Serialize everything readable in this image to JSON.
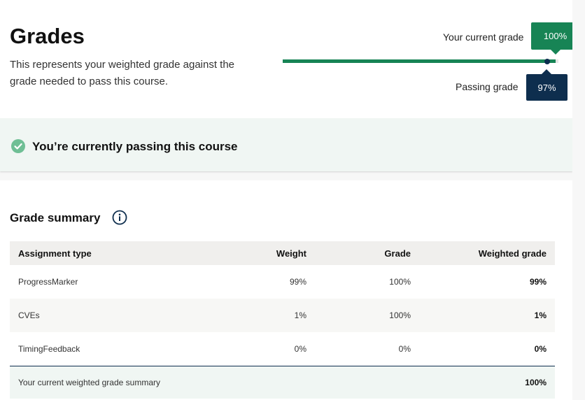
{
  "header": {
    "title": "Grades",
    "description": "This represents your weighted grade against the grade needed to pass this course."
  },
  "progress": {
    "current_label": "Your current grade",
    "current_value": "100%",
    "current_fraction": 1.0,
    "passing_label": "Passing grade",
    "passing_value": "97%",
    "passing_fraction": 0.97,
    "fill_color": "#178455",
    "marker_color": "#0e2e4e"
  },
  "status": {
    "icon": "check-circle-icon",
    "text": "You’re currently passing this course",
    "color": "#178455"
  },
  "summary": {
    "title": "Grade summary",
    "info_icon": "info-icon",
    "columns": [
      "Assignment type",
      "Weight",
      "Grade",
      "Weighted grade"
    ],
    "rows": [
      {
        "type": "ProgressMarker",
        "weight": "99%",
        "grade": "100%",
        "weighted": "99%"
      },
      {
        "type": "CVEs",
        "weight": "1%",
        "grade": "100%",
        "weighted": "1%"
      },
      {
        "type": "TimingFeedback",
        "weight": "0%",
        "grade": "0%",
        "weighted": "0%"
      }
    ],
    "footer_label": "Your current weighted grade summary",
    "footer_value": "100%"
  }
}
